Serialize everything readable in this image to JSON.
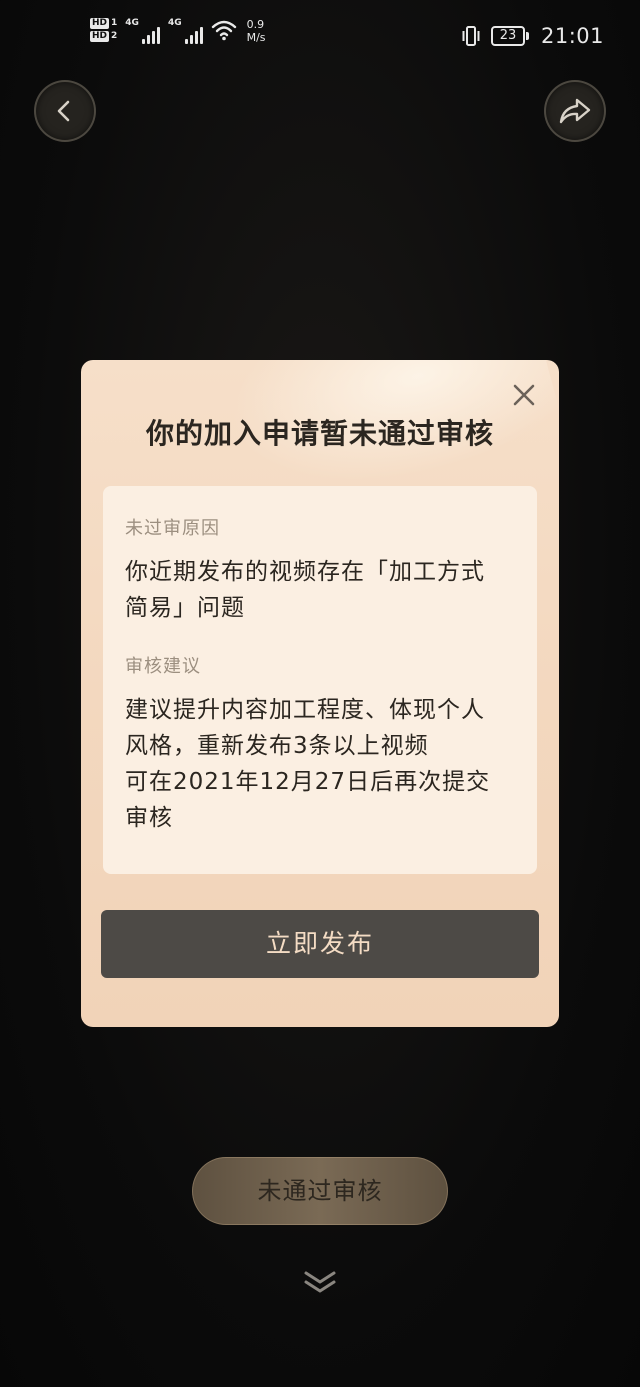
{
  "status_bar": {
    "hd1": "HD",
    "hd1_slot": "1",
    "hd2": "HD",
    "hd2_slot": "2",
    "network1": "4G",
    "network2": "4G",
    "speed_value": "0.9",
    "speed_unit": "M/s",
    "battery": "23",
    "time": "21:01"
  },
  "icons": {
    "back": "chevron-left-icon",
    "share": "share-arrow-icon",
    "close": "close-icon",
    "more": "double-chevron-down-icon"
  },
  "dialog": {
    "title": "你的加入申请暂未通过审核",
    "reason_label": "未过审原因",
    "reason_lines": [
      "你近期发布的视频存在「加工方式",
      "简易」问题"
    ],
    "advice_label": "审核建议",
    "advice_lines": [
      "建议提升内容加工程度、体现个人",
      "风格，重新发布3条以上视频",
      "可在2021年12月27日后再次提交",
      "审核"
    ],
    "publish_label": "立即发布"
  },
  "background": {
    "status_pill": "未通过审核"
  },
  "colors": {
    "dialog_bg": "#f4dac2",
    "card_bg": "#fbefe2",
    "button_bg": "#4d4a46",
    "button_text": "#f4dcc4",
    "pill_bg": "#6b5c48"
  }
}
